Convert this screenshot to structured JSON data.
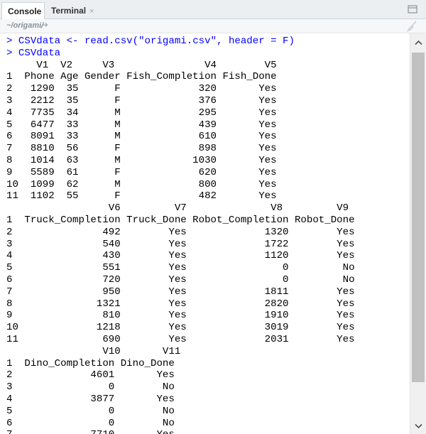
{
  "tabs": {
    "console": "Console",
    "terminal": "Terminal",
    "terminal_close": "×"
  },
  "path": "~/origami/",
  "console": {
    "prompt": "> ",
    "commands": [
      "CSVdata <- read.csv(\"origami.csv\", header = F)",
      "CSVdata"
    ],
    "output": "     V1  V2     V3               V4        V5\n1  Phone Age Gender Fish_Completion Fish_Done\n2   1290  35      F             320       Yes\n3   2212  35      F             376       Yes\n4   7735  34      M             295       Yes\n5   6477  33      M             439       Yes\n6   8091  33      M             610       Yes\n7   8810  56      F             898       Yes\n8   1014  63      M            1030       Yes\n9   5589  61      F             620       Yes\n10  1099  62      M             800       Yes\n11  1102  55      F             482       Yes\n                 V6         V7              V8         V9\n1  Truck_Completion Truck_Done Robot_Completion Robot_Done\n2               492        Yes             1320        Yes\n3               540        Yes             1722        Yes\n4               430        Yes             1120        Yes\n5               551        Yes                0         No\n6               720        Yes                0         No\n7               950        Yes             1811        Yes\n8              1321        Yes             2820        Yes\n9               810        Yes             1910        Yes\n10             1218        Yes             3019        Yes\n11              690        Yes             2031        Yes\n                V10       V11\n1  Dino_Completion Dino_Done\n2             4601       Yes\n3                0        No\n4             3877       Yes\n5                0        No\n6                0        No\n7             7710       Yes"
  },
  "colors": {
    "command": "#0000ff",
    "output": "#000000",
    "tab_bar": "#eceff2"
  }
}
